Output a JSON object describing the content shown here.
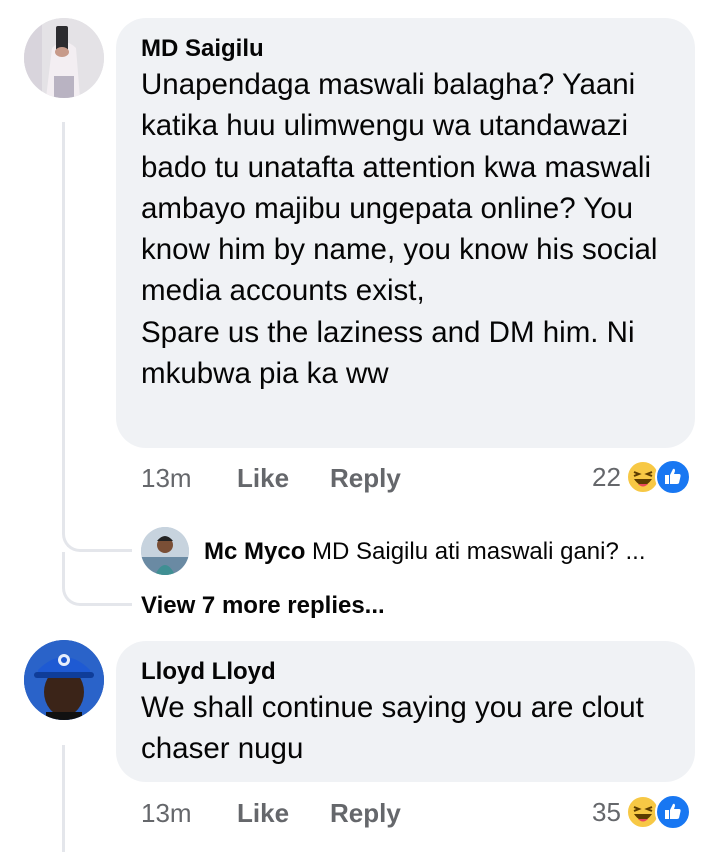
{
  "comments": [
    {
      "author": "MD Saigilu",
      "text": "Unapendaga maswali balagha? Yaani katika huu ulimwengu wa utandawazi bado tu unatafta attention kwa maswali ambayo majibu ungepata online? You know him by name, you know his social media accounts exist,\nSpare us the laziness and DM him. Ni mkubwa pia ka ww",
      "time": "13m",
      "like_label": "Like",
      "reply_label": "Reply",
      "reaction_count": "22",
      "reactions": [
        "haha-icon",
        "like-icon"
      ],
      "replies": [
        {
          "author": "Mc Myco",
          "text": "MD Saigilu  ati maswali gani? ..."
        }
      ],
      "more_replies_label": "View 7 more replies..."
    },
    {
      "author": "Lloyd Lloyd",
      "text": "We shall continue saying you are clout chaser nugu",
      "time": "13m",
      "like_label": "Like",
      "reply_label": "Reply",
      "reaction_count": "35",
      "reactions": [
        "haha-icon",
        "like-icon"
      ]
    }
  ],
  "colors": {
    "bubble": "#f0f2f5",
    "meta_text": "#65676b",
    "like_blue": "#1877f2",
    "haha_yellow": "#f7c845",
    "thread_line": "#e4e6eb"
  }
}
